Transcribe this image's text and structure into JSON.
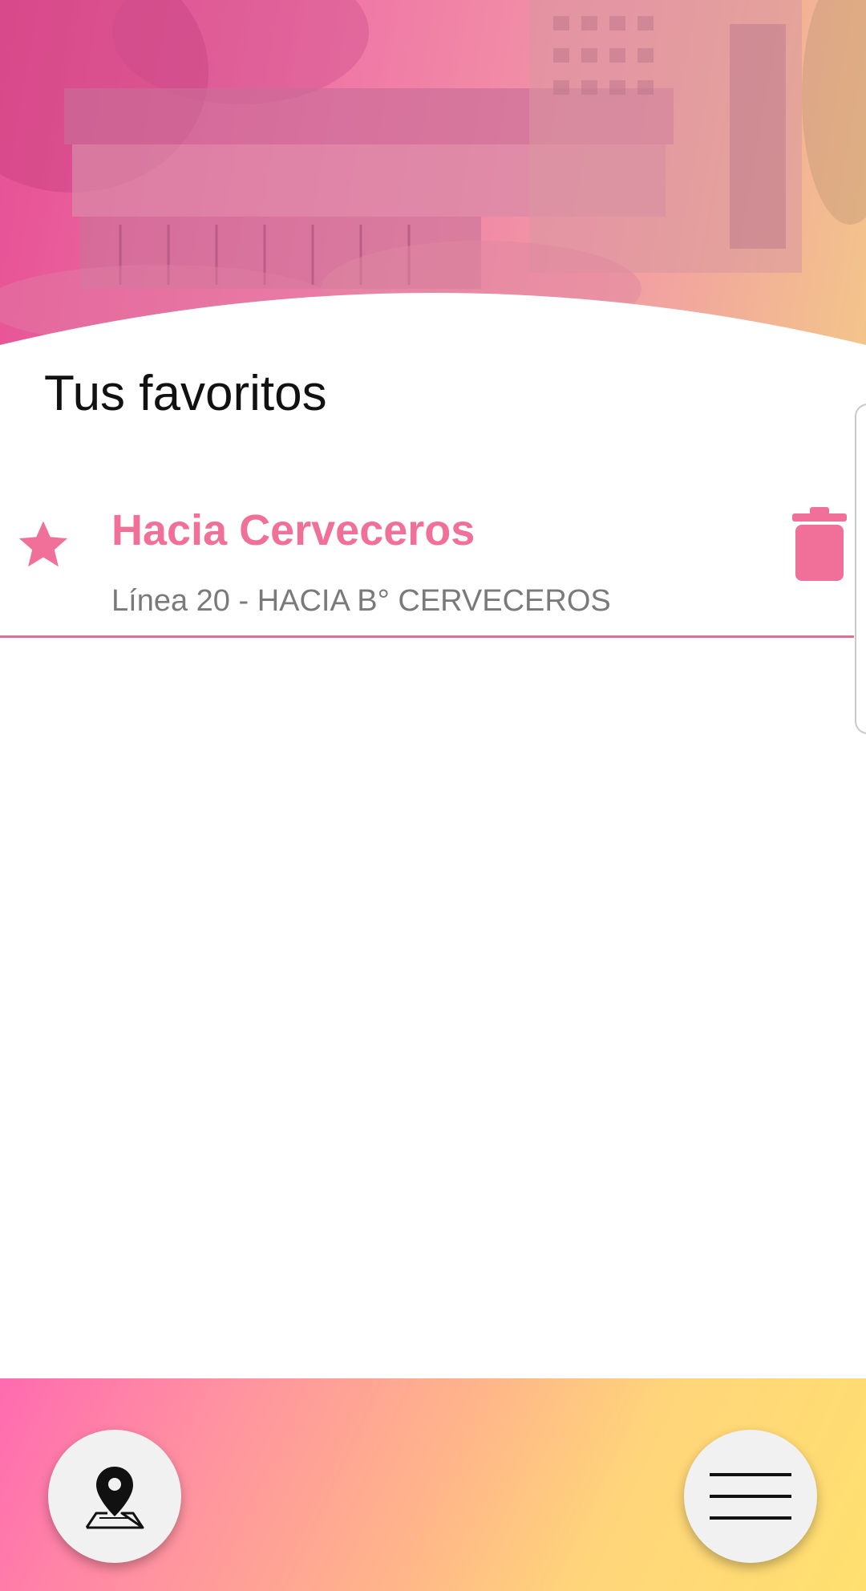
{
  "favorites": {
    "title": "Tus favoritos",
    "items": [
      {
        "name": "Hacia Cerveceros",
        "line": "Línea 20 - HACIA B° CERVECEROS"
      }
    ]
  },
  "icons": {
    "favorite": "star-icon",
    "delete": "trash-icon",
    "map": "map-pin-icon",
    "menu": "hamburger-menu-icon"
  },
  "colors": {
    "accent": "#f0709a",
    "divider": "#d9729a",
    "subtitle": "#7a7a7a",
    "title": "#111111"
  }
}
